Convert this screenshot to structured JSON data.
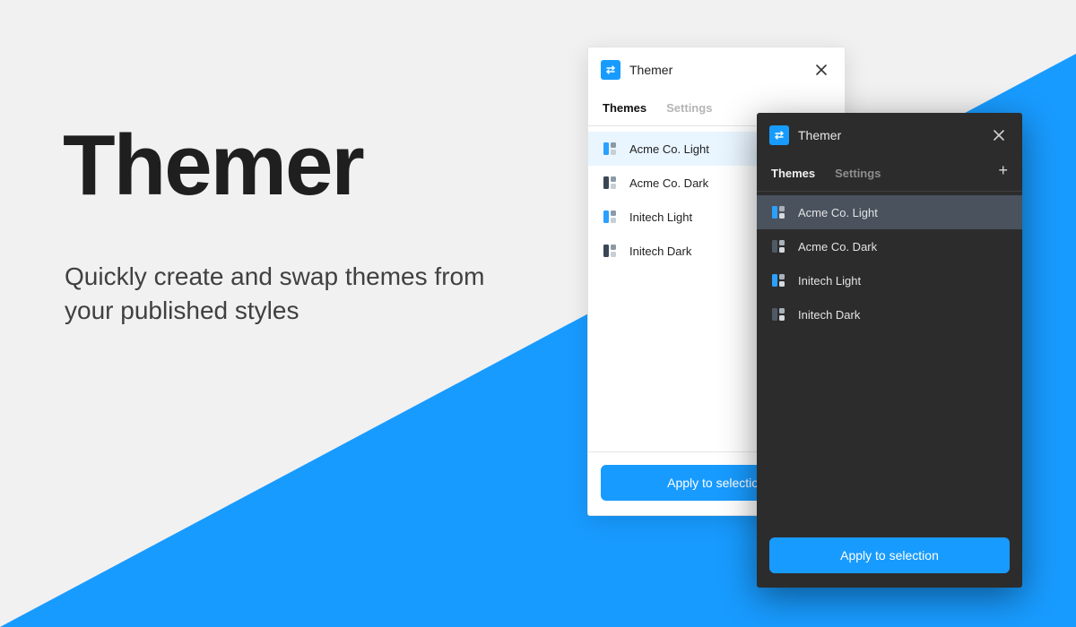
{
  "colors": {
    "accent": "#189bff"
  },
  "hero": {
    "title": "Themer",
    "subtitle": "Quickly create and swap themes from your published styles"
  },
  "panel_light": {
    "title": "Themer",
    "tabs": {
      "themes": "Themes",
      "settings": "Settings"
    },
    "themes": [
      {
        "label": "Acme Co. Light",
        "selected": true
      },
      {
        "label": "Acme Co. Dark"
      },
      {
        "label": "Initech Light"
      },
      {
        "label": "Initech Dark"
      }
    ],
    "apply_label": "Apply to selection"
  },
  "panel_dark": {
    "title": "Themer",
    "tabs": {
      "themes": "Themes",
      "settings": "Settings"
    },
    "themes": [
      {
        "label": "Acme Co. Light",
        "selected": true
      },
      {
        "label": "Acme Co. Dark"
      },
      {
        "label": "Initech Light"
      },
      {
        "label": "Initech Dark"
      }
    ],
    "apply_label": "Apply to selection"
  }
}
